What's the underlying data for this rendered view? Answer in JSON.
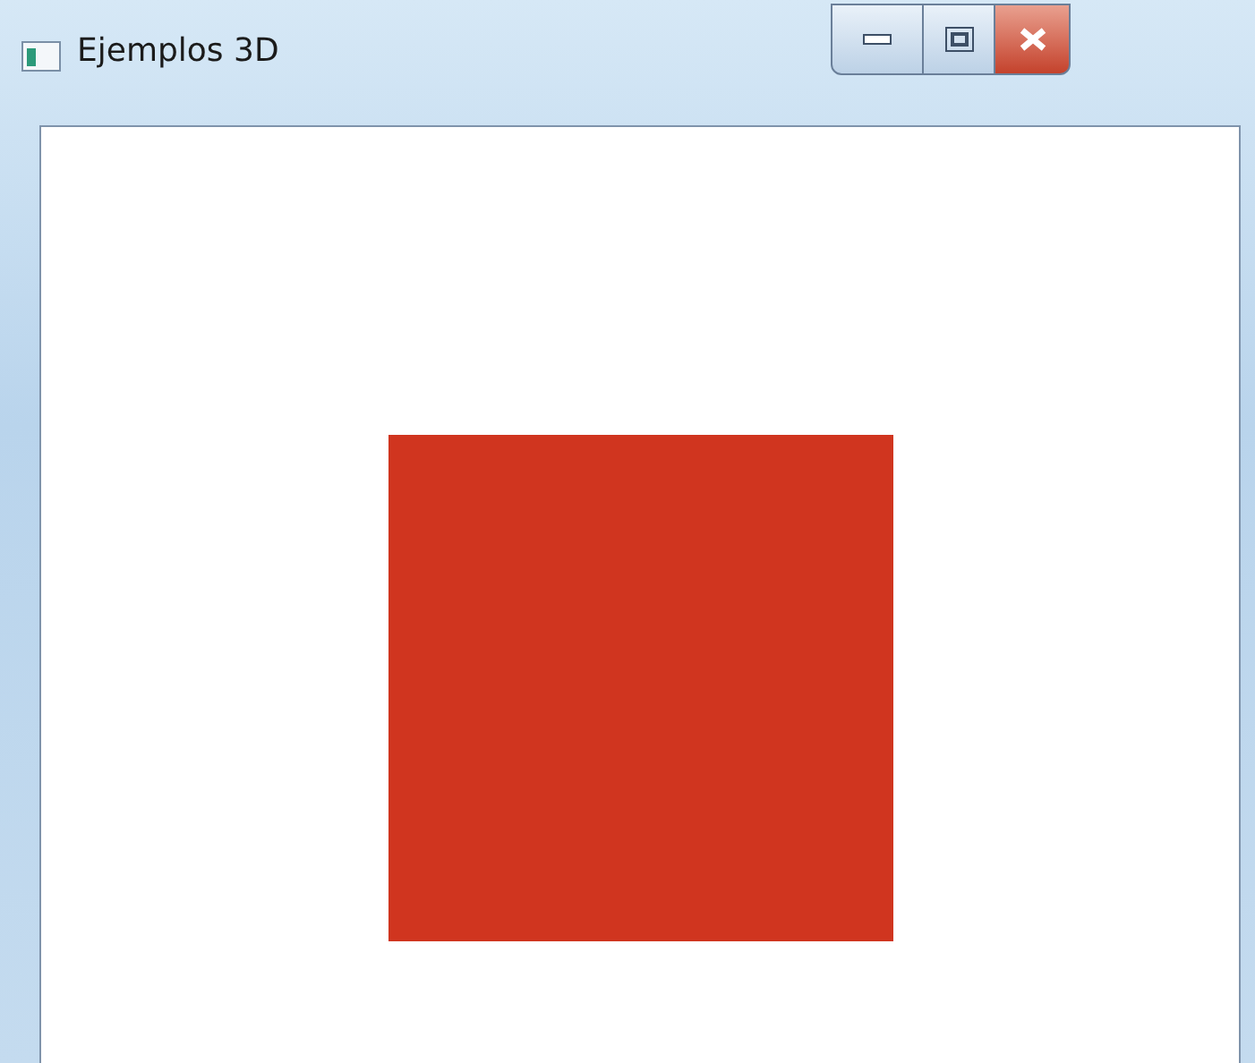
{
  "window": {
    "title": "Ejemplos 3D"
  },
  "scene": {
    "kind": "square"
  }
}
